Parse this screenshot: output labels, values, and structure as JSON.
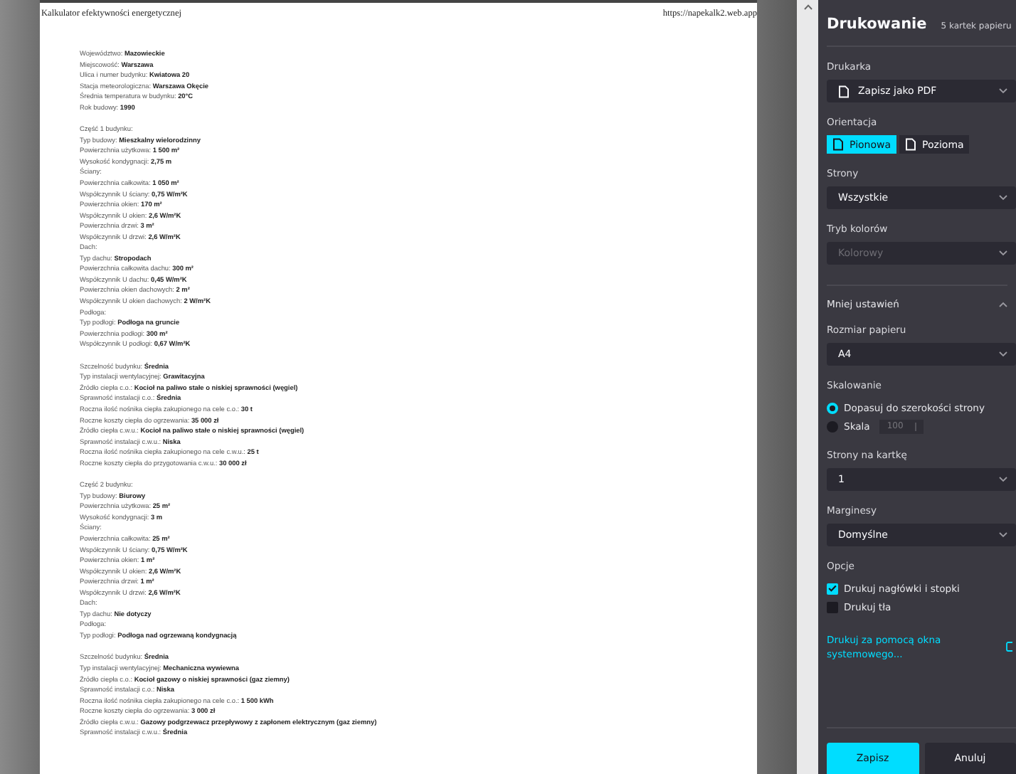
{
  "document": {
    "header_title": "Kalkulator efektywności energetycznej",
    "header_url": "https://napekalk2.web.app",
    "sections": [
      [
        "Województwo: **Mazowieckie**",
        "Miejscowość: **Warszawa**",
        "Ulica i numer budynku: **Kwiatowa 20**",
        "Stacja meteorologiczna: **Warszawa Okęcie**",
        "Średnia temperatura w budynku: **20°C**",
        "Rok budowy: **1990**"
      ],
      [
        "Część 1 budynku:",
        "Typ budowy: **Mieszkalny wielorodzinny**",
        "Powierzchnia użytkowa: **1 500 m²**",
        "Wysokość kondygnacji: **2,75 m**",
        "Ściany:",
        "Powierzchnia całkowita: **1 050 m²**",
        "Współczynnik U ściany: **0,75 W/m²K**",
        "Powierzchnia okien: **170 m²**",
        "Współczynnik U okien: **2,6 W/m²K**",
        "Powierzchnia drzwi: **3 m²**",
        "Współczynnik U drzwi: **2,6 W/m²K**",
        "Dach:",
        "Typ dachu: **Stropodach**",
        "Powierzchnia całkowita dachu: **300 m²**",
        "Współczynnik U dachu: **0,45 W/m²K**",
        "Powierzchnia okien dachowych: **2 m²**",
        "Współczynnik U okien dachowych: **2 W/m²K**",
        "Podłoga:",
        "Typ podłogi: **Podłoga na gruncie**",
        "Powierzchnia podłogi: **300 m²**",
        "Współczynnik U podłogi: **0,67 W/m²K**"
      ],
      [
        "Szczelność budynku: **Średnia**",
        "Typ instalacji wentylacyjnej: **Grawitacyjna**",
        "Źródło ciepła c.o.: **Kocioł na paliwo stałe o niskiej sprawności (węgiel)**",
        "Sprawność instalacji c.o.: **Średnia**",
        "Roczna ilość nośnika ciepła zakupionego na cele c.o.: **30 t**",
        "Roczne koszty ciepła do ogrzewania: **35 000 zł**",
        "Źródło ciepła c.w.u.: **Kocioł na paliwo stałe o niskiej sprawności (węgiel)**",
        "Sprawność instalacji c.w.u.: **Niska**",
        "Roczna ilość nośnika ciepła zakupionego na cele c.w.u.: **25 t**",
        "Roczne koszty ciepła do przygotowania c.w.u.: **30 000 zł**"
      ],
      [
        "Część 2 budynku:",
        "Typ budowy: **Biurowy**",
        "Powierzchnia użytkowa: **25 m²**",
        "Wysokość kondygnacji: **3 m**",
        "Ściany:",
        "Powierzchnia całkowita: **25 m²**",
        "Współczynnik U ściany: **0,75 W/m²K**",
        "Powierzchnia okien: **1 m²**",
        "Współczynnik U okien: **2,6 W/m²K**",
        "Powierzchnia drzwi: **1 m²**",
        "Współczynnik U drzwi: **2,6 W/m²K**",
        "Dach:",
        "Typ dachu: **Nie dotyczy**",
        "Podłoga:",
        "Typ podłogi: **Podłoga nad ogrzewaną kondygnacją**"
      ],
      [
        "Szczelność budynku: **Średnia**",
        "Typ instalacji wentylacyjnej: **Mechaniczna wywiewna**",
        "Źródło ciepła c.o.: **Kocioł gazowy o niskiej sprawności (gaz ziemny)**",
        "Sprawność instalacji c.o.: **Niska**",
        "Roczna ilość nośnika ciepła zakupionego na cele c.o.: **1 500 kWh**",
        "Roczne koszty ciepła do ogrzewania: **3 000 zł**",
        "Źródło ciepła c.w.u.: **Gazowy podgrzewacz przepływowy z zapłonem elektrycznym (gaz ziemny)**",
        "Sprawność instalacji c.w.u.: **Średnia**"
      ]
    ]
  },
  "panel": {
    "title": "Drukowanie",
    "sheets": "5 kartek papieru",
    "controls": [
      {
        "kind": "select",
        "label": "Drukarka",
        "value": "Zapisz jako PDF",
        "disabled": false
      },
      {
        "kind": "segmented",
        "label": "Orientacja",
        "options": [
          {
            "text": "Pionowa",
            "selected": true
          },
          {
            "text": "Pozioma",
            "selected": false
          }
        ]
      },
      {
        "kind": "select",
        "label": "Strony",
        "value": "Wszystkie",
        "disabled": false
      },
      {
        "kind": "select",
        "label": "Tryb kolorów",
        "value": "Kolorowy",
        "disabled": true
      },
      {
        "kind": "more",
        "text": "Mniej ustawień",
        "expanded": true
      },
      {
        "kind": "select",
        "label": "Rozmiar papieru",
        "value": "A4",
        "disabled": false
      },
      {
        "kind": "radios",
        "label": "Skalowanie",
        "options": [
          {
            "text": "Dopasuj do szerokości strony",
            "selected": true
          },
          {
            "text": "Skala",
            "selected": false,
            "input": "100"
          }
        ]
      },
      {
        "kind": "select",
        "label": "Strony na kartkę",
        "value": "1",
        "disabled": false
      },
      {
        "kind": "select",
        "label": "Marginesy",
        "value": "Domyślne",
        "disabled": false
      },
      {
        "kind": "checks",
        "label": "Opcje",
        "options": [
          {
            "text": "Drukuj nagłówki i stopki",
            "checked": true
          },
          {
            "text": "Drukuj tła",
            "checked": false
          }
        ]
      },
      {
        "kind": "link",
        "text": "Drukuj za pomocą okna systemowego..."
      }
    ],
    "buttons": [
      {
        "text": "Zapisz",
        "primary": true
      },
      {
        "text": "Anuluj",
        "primary": false
      }
    ]
  }
}
